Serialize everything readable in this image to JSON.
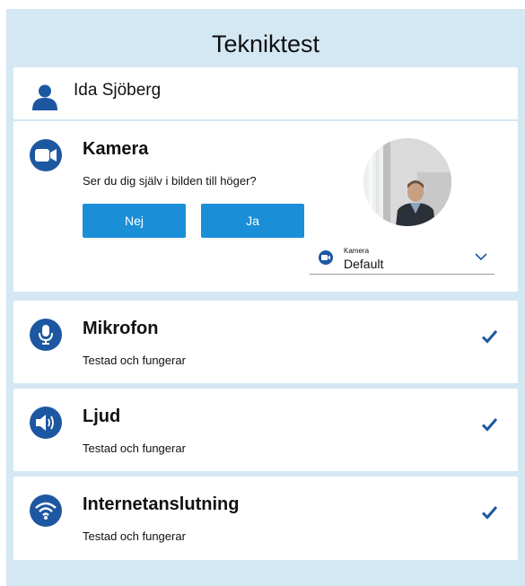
{
  "page": {
    "title": "Tekniktest"
  },
  "user": {
    "name": "Ida Sjöberg",
    "icon": "person-icon"
  },
  "camera": {
    "title": "Kamera",
    "question": "Ser du dig själv i bilden till höger?",
    "no_label": "Nej",
    "yes_label": "Ja",
    "select_label": "Kamera",
    "select_value": "Default",
    "icon": "video-camera-icon"
  },
  "microphone": {
    "title": "Mikrofon",
    "status": "Testad och fungerar",
    "icon": "microphone-icon"
  },
  "audio": {
    "title": "Ljud",
    "status": "Testad och fungerar",
    "icon": "speaker-icon"
  },
  "internet": {
    "title": "Internetanslutning",
    "status": "Testad och fungerar",
    "icon": "wifi-icon"
  },
  "colors": {
    "background": "#d4e8f3",
    "accent_dark": "#1d57a1",
    "button": "#1a8fd8",
    "card": "#ffffff"
  }
}
